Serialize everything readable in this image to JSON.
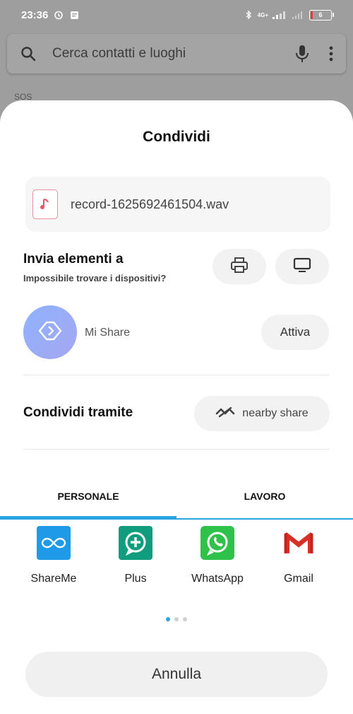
{
  "status_bar": {
    "time": "23:36",
    "network_label": "4G+",
    "battery_level": "6",
    "battery_fill_fraction": 0.06,
    "icons": [
      "alarm-icon",
      "notification-icon",
      "bluetooth-icon",
      "signal-icon",
      "battery-icon"
    ]
  },
  "search": {
    "placeholder": "Cerca contatti e luoghi",
    "icons": [
      "search-icon",
      "mic-icon",
      "more-icon"
    ]
  },
  "background_peek": "SOS",
  "sheet": {
    "title": "Condividi",
    "file": {
      "name": "record-1625692461504.wav",
      "icon": "audio-file-icon",
      "accent": "#e2576a"
    },
    "send_to": {
      "title": "Invia elementi a",
      "subtitle": "Impossibile trovare i dispositivi?",
      "devices": [
        "printer-icon",
        "tv-icon"
      ]
    },
    "mishare": {
      "label": "Mi Share",
      "button": "Attiva"
    },
    "share_via": {
      "title": "Condividi tramite",
      "nearby_label": "nearby share"
    },
    "tabs": [
      {
        "label": "PERSONALE",
        "active": true
      },
      {
        "label": "LAVORO",
        "active": false
      }
    ],
    "apps": [
      {
        "label": "ShareMe",
        "icon": "shareme-icon",
        "color": "#1e9ae8"
      },
      {
        "label": "Plus",
        "icon": "plus-icon",
        "color": "#0f9d7e"
      },
      {
        "label": "WhatsApp",
        "icon": "whatsapp-icon",
        "color": "#2fc24a"
      },
      {
        "label": "Gmail",
        "icon": "gmail-icon",
        "color": "#d93025"
      }
    ],
    "page_indicator": {
      "pages": 3,
      "current": 1
    },
    "cancel": "Annulla",
    "accent_color": "#2aa3e0"
  }
}
